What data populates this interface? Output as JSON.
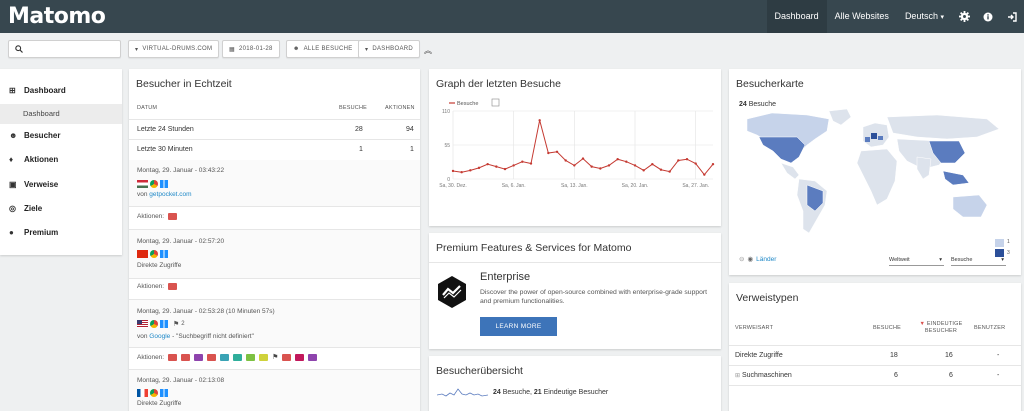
{
  "app": {
    "logo": "Matomo"
  },
  "topnav": {
    "dashboard": "Dashboard",
    "all_websites": "Alle Websites",
    "language": "Deutsch",
    "language_caret": "▾"
  },
  "toolbar": {
    "site": "VIRTUAL-DRUMS.COM",
    "date": "2018-01-28",
    "segment": "ALLE BESUCHE",
    "dashboard": "DASHBOARD",
    "collapse": "︽"
  },
  "sidebar": {
    "items": [
      {
        "label": "Dashboard",
        "icon": "grid-icon",
        "glyph": "⊞"
      },
      {
        "label": "Besucher",
        "icon": "mask-icon",
        "glyph": "☻"
      },
      {
        "label": "Aktionen",
        "icon": "bell-icon",
        "glyph": "♦"
      },
      {
        "label": "Verweise",
        "icon": "referrer-icon",
        "glyph": "▣"
      },
      {
        "label": "Ziele",
        "icon": "target-icon",
        "glyph": "◎"
      },
      {
        "label": "Premium",
        "icon": "premium-icon",
        "glyph": "●"
      }
    ],
    "sub": "Dashboard"
  },
  "realtime": {
    "title": "Besucher in Echtzeit",
    "headers": {
      "date": "DATUM",
      "visits": "BESUCHE",
      "actions": "AKTIONEN"
    },
    "rows": [
      {
        "label": "Letzte 24 Stunden",
        "visits": "28",
        "actions": "94"
      },
      {
        "label": "Letzte 30 Minuten",
        "visits": "1",
        "actions": "1"
      }
    ],
    "visits": [
      {
        "date": "Montag, 29. Januar - 03:43:22",
        "source_prefix": "von ",
        "source_link": "getpocket.com",
        "source_suffix": "",
        "actions_label": "Aktionen:",
        "flag": "hungary",
        "extra": ""
      },
      {
        "date": "Montag, 29. Januar - 02:57:20",
        "source_prefix": "Direkte Zugriffe",
        "source_link": "",
        "source_suffix": "",
        "actions_label": "Aktionen:",
        "flag": "china",
        "extra": ""
      },
      {
        "date": "Montag, 29. Januar - 02:53:28 (10 Minuten 57s)",
        "source_prefix": "von ",
        "source_link": "Google",
        "source_suffix": " - \"Suchbegriff nicht definiert\"",
        "actions_label": "Aktionen:",
        "flag": "usa",
        "extra": "2"
      },
      {
        "date": "Montag, 29. Januar - 02:13:08",
        "source_prefix": "Direkte Zugriffe",
        "source_link": "",
        "source_suffix": "",
        "actions_label": "",
        "flag": "france",
        "extra": ""
      }
    ]
  },
  "graph": {
    "title": "Graph der letzten Besuche",
    "legend": "Besuche"
  },
  "chart_data": {
    "type": "line",
    "x": [
      "Sa, 30. Dez.",
      "So, 31. Dez.",
      "Mo, 1. Jan.",
      "Di, 2. Jan.",
      "Mi, 3. Jan.",
      "Do, 4. Jan.",
      "Fr, 5. Jan.",
      "Sa, 6. Jan.",
      "So, 7. Jan.",
      "Mo, 8. Jan.",
      "Di, 9. Jan.",
      "Mi, 10. Jan.",
      "Do, 11. Jan.",
      "Fr, 12. Jan.",
      "Sa, 13. Jan.",
      "So, 14. Jan.",
      "Mo, 15. Jan.",
      "Di, 16. Jan.",
      "Mi, 17. Jan.",
      "Do, 18. Jan.",
      "Fr, 19. Jan.",
      "Sa, 20. Jan.",
      "So, 21. Jan.",
      "Mo, 22. Jan.",
      "Di, 23. Jan.",
      "Mi, 24. Jan.",
      "Do, 25. Jan.",
      "Fr, 26. Jan.",
      "Sa, 27. Jan.",
      "So, 28. Jan."
    ],
    "series": [
      {
        "name": "Besuche",
        "values": [
          13,
          11,
          14,
          18,
          24,
          20,
          16,
          22,
          28,
          25,
          95,
          42,
          44,
          30,
          22,
          33,
          20,
          17,
          22,
          32,
          28,
          22,
          14,
          24,
          15,
          12,
          30,
          32,
          25,
          7,
          24
        ]
      }
    ],
    "xticks": [
      "Sa, 30. Dez.",
      "Sa, 6. Jan.",
      "Sa, 13. Jan.",
      "Sa, 20. Jan.",
      "Sa, 27. Jan."
    ],
    "yticks": [
      "110",
      "55",
      "0"
    ],
    "ylim": [
      0,
      110
    ],
    "grid": true,
    "color": "#c53a32"
  },
  "premium": {
    "title": "Premium Features & Services for Matomo",
    "heading": "Enterprise",
    "text": "Discover the power of open-source combined with enterprise-grade support and premium functionalities.",
    "button": "LEARN MORE"
  },
  "overview": {
    "title": "Besucherübersicht",
    "visits": "24",
    "visits_label": " Besuche, ",
    "unique": "21",
    "unique_label": " Eindeutige Besucher"
  },
  "map": {
    "title": "Besucherkarte",
    "count": "24",
    "count_label": " Besuche",
    "countries": "Länder",
    "scope": "Weltweit",
    "metric": "Besuche",
    "legend_min": "1",
    "legend_max": "3"
  },
  "referrers": {
    "title": "Verweistypen",
    "headers": {
      "type": "VERWEISART",
      "visits": "BESUCHE",
      "unique": "EINDEUTIGE BESUCHER",
      "users": "BENUTZER"
    },
    "rows": [
      {
        "label": "Direkte Zugriffe",
        "visits": "18",
        "unique": "16",
        "users": "-"
      },
      {
        "label": "Suchmaschinen",
        "visits": "6",
        "unique": "6",
        "users": "-"
      }
    ]
  },
  "colors": {
    "topbar": "#37474f",
    "accent": "#3d74b9",
    "line": "#c53a32",
    "map_high": "#5b7cbf",
    "map_low": "#c6d3ea"
  }
}
